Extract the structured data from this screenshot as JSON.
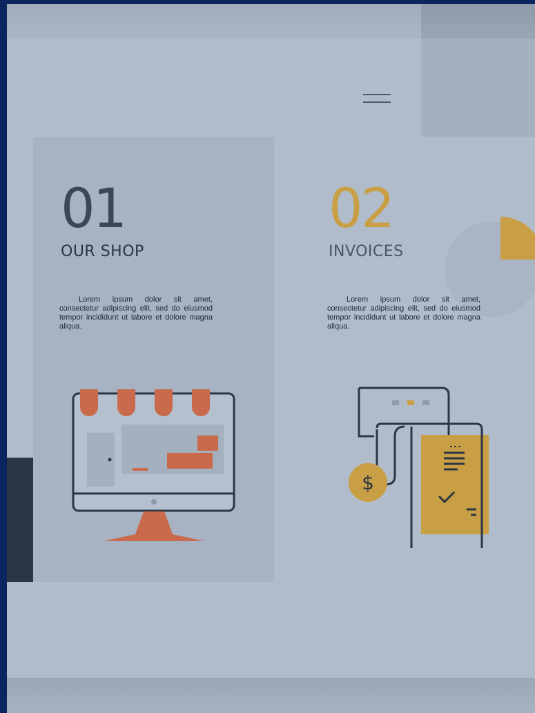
{
  "colors": {
    "background": "#b1bccb",
    "card": "#a7b2c2",
    "dark": "#2c3543",
    "accent_orange": "#c96a4c",
    "accent_gold": "#c99f45",
    "line": "#2c3543",
    "frame": "#0b255e"
  },
  "header": {
    "menu_icon": "hamburger-icon"
  },
  "features": [
    {
      "number": "01",
      "title": "OUR SHOP",
      "description": "Lorem ipsum dolor sit amet, consectetur adipiscing elit, sed do eiusmod tempor incididunt ut labore et dolore magna aliqua.",
      "icon": "storefront-monitor-icon"
    },
    {
      "number": "02",
      "title": "INVOICES",
      "description": "Lorem ipsum dolor sit amet, consectetur adipiscing elit, sed do eiusmod tempor incididunt ut labore et dolore magna aliqua.",
      "icon": "invoice-receipt-icon",
      "decoration": "pie-chart-icon"
    }
  ]
}
